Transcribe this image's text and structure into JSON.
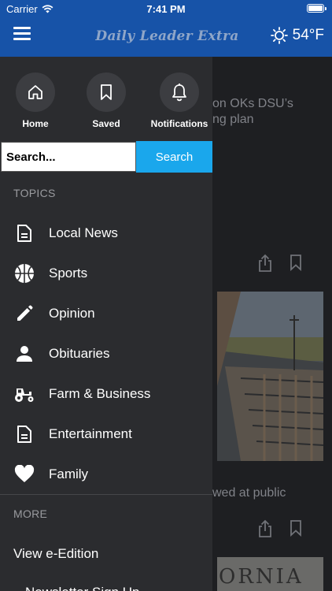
{
  "status_bar": {
    "carrier": "Carrier",
    "time": "7:41 PM"
  },
  "header": {
    "logo_text": "Daily Leader Extra",
    "temperature": "54°F",
    "weather_icon": "sun-icon",
    "accent": "#1753a8"
  },
  "drawer": {
    "quick_actions": [
      {
        "label": "Home",
        "icon": "home-icon"
      },
      {
        "label": "Saved",
        "icon": "bookmark-icon"
      },
      {
        "label": "Notifications",
        "icon": "bell-icon"
      }
    ],
    "search": {
      "placeholder": "Search...",
      "button_label": "Search"
    },
    "topics_title": "TOPICS",
    "topics": [
      {
        "label": "Local News",
        "icon": "document-icon"
      },
      {
        "label": "Sports",
        "icon": "basketball-icon"
      },
      {
        "label": "Opinion",
        "icon": "pencil-icon"
      },
      {
        "label": "Obituaries",
        "icon": "person-icon"
      },
      {
        "label": "Farm & Business",
        "icon": "tractor-icon"
      },
      {
        "label": "Entertainment",
        "icon": "document-icon"
      },
      {
        "label": "Family",
        "icon": "heart-icon"
      }
    ],
    "more_title": "MORE",
    "more_items": [
      {
        "label": "View e-Edition"
      },
      {
        "label": "Newsletter Sign Up"
      }
    ]
  },
  "background": {
    "headline_1_line_1": "on OKs DSU’s",
    "headline_1_line_2": "ng plan",
    "headline_2": "wed at public",
    "photo_2_text": "ORNIA"
  }
}
